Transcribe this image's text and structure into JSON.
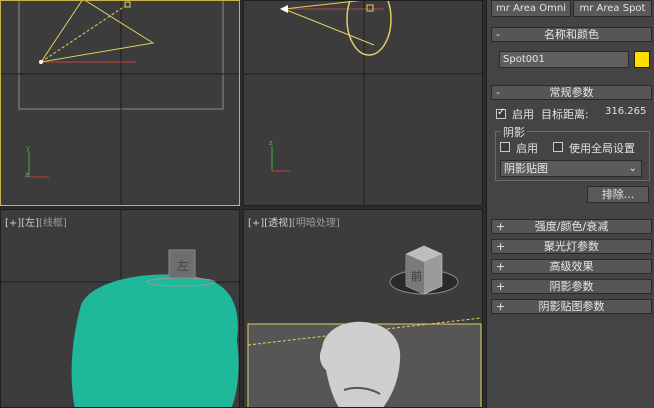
{
  "viewports": {
    "left": {
      "bracket": "[+]",
      "view": "[左]",
      "shading": "[线框]"
    },
    "perspective": {
      "bracket": "[+]",
      "view": "[透视]",
      "shading": "[明暗处理]"
    },
    "cube_left_label": "左",
    "cube_front_label": "前"
  },
  "panel": {
    "top_buttons": [
      "mr Area Omni",
      "mr Area Spot"
    ],
    "name_color": {
      "title": "名称和颜色",
      "name_value": "Spot001",
      "color": "#ffdf00"
    },
    "general": {
      "title": "常规参数",
      "enable_label": "启用",
      "target_distance_label": "目标距离:",
      "target_distance_value": "316.265",
      "shadow_group_label": "阴影",
      "shadow_enable_label": "启用",
      "global_settings_label": "使用全局设置",
      "shadow_type": "阴影贴图",
      "exclude_button": "排除..."
    },
    "collapsed_rollouts": [
      "强度/颜色/衰减",
      "聚光灯参数",
      "高级效果",
      "阴影参数",
      "阴影贴图参数"
    ]
  }
}
